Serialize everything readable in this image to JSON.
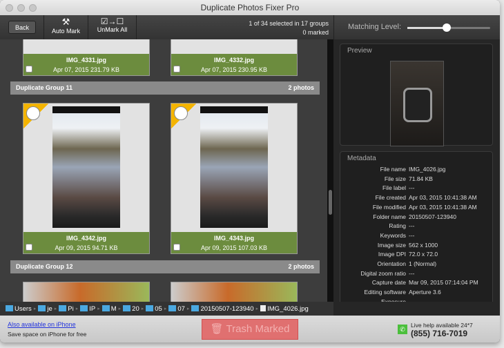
{
  "window": {
    "title": "Duplicate Photos Fixer Pro"
  },
  "toolbar": {
    "back": "Back",
    "auto_mark": "Auto Mark",
    "unmark_all": "UnMark All",
    "status_line1": "1 of 34 selected in 17 groups",
    "status_line2": "0 marked",
    "matching_level_label": "Matching Level:",
    "matching_level_value": 0.45
  },
  "groups": [
    {
      "cards": [
        {
          "name": "IMG_4331.jpg",
          "info": "Apr 07, 2015  231.79 KB"
        },
        {
          "name": "IMG_4332.jpg",
          "info": "Apr 07, 2015  230.95 KB"
        }
      ]
    },
    {
      "title": "Duplicate Group 11",
      "count": "2 photos",
      "cards": [
        {
          "name": "IMG_4342.jpg",
          "info": "Apr 09, 2015  94.71 KB"
        },
        {
          "name": "IMG_4343.jpg",
          "info": "Apr 09, 2015  107.03 KB"
        }
      ]
    },
    {
      "title": "Duplicate Group 12",
      "count": "2 photos"
    }
  ],
  "preview": {
    "title": "Preview"
  },
  "metadata": {
    "title": "Metadata",
    "rows": [
      {
        "k": "File name",
        "v": "IMG_4026.jpg"
      },
      {
        "k": "File size",
        "v": "71.84 KB"
      },
      {
        "k": "File label",
        "v": "---"
      },
      {
        "k": "File created",
        "v": "Apr 03, 2015 10:41:38 AM"
      },
      {
        "k": "File modified",
        "v": "Apr 03, 2015 10:41:38 AM"
      },
      {
        "k": "Folder name",
        "v": "20150507-123940"
      },
      {
        "k": "Rating",
        "v": "---"
      },
      {
        "k": "Keywords",
        "v": "---"
      },
      {
        "k": "Image size",
        "v": "562 x 1000"
      },
      {
        "k": "Image DPI",
        "v": "72.0 x 72.0"
      },
      {
        "k": "Orientation",
        "v": "1 (Normal)"
      },
      {
        "k": "Digital zoom ratio",
        "v": "---"
      },
      {
        "k": "Capture date",
        "v": "Mar 09, 2015 07:14:04 PM"
      },
      {
        "k": "Editing software",
        "v": "Aperture 3.6"
      },
      {
        "k": "Exposure",
        "v": "---"
      }
    ]
  },
  "path": [
    "Users",
    "je",
    "Pi",
    "IP",
    "M",
    "20",
    "05",
    "07",
    "20150507-123940",
    "IMG_4026.jpg"
  ],
  "bottom": {
    "iphone_link": "Also available on iPhone",
    "iphone_sub": "Save space on iPhone for free",
    "trash": "Trash Marked",
    "help_line": "Live help available 24*7",
    "phone": "(855) 716-7019"
  }
}
